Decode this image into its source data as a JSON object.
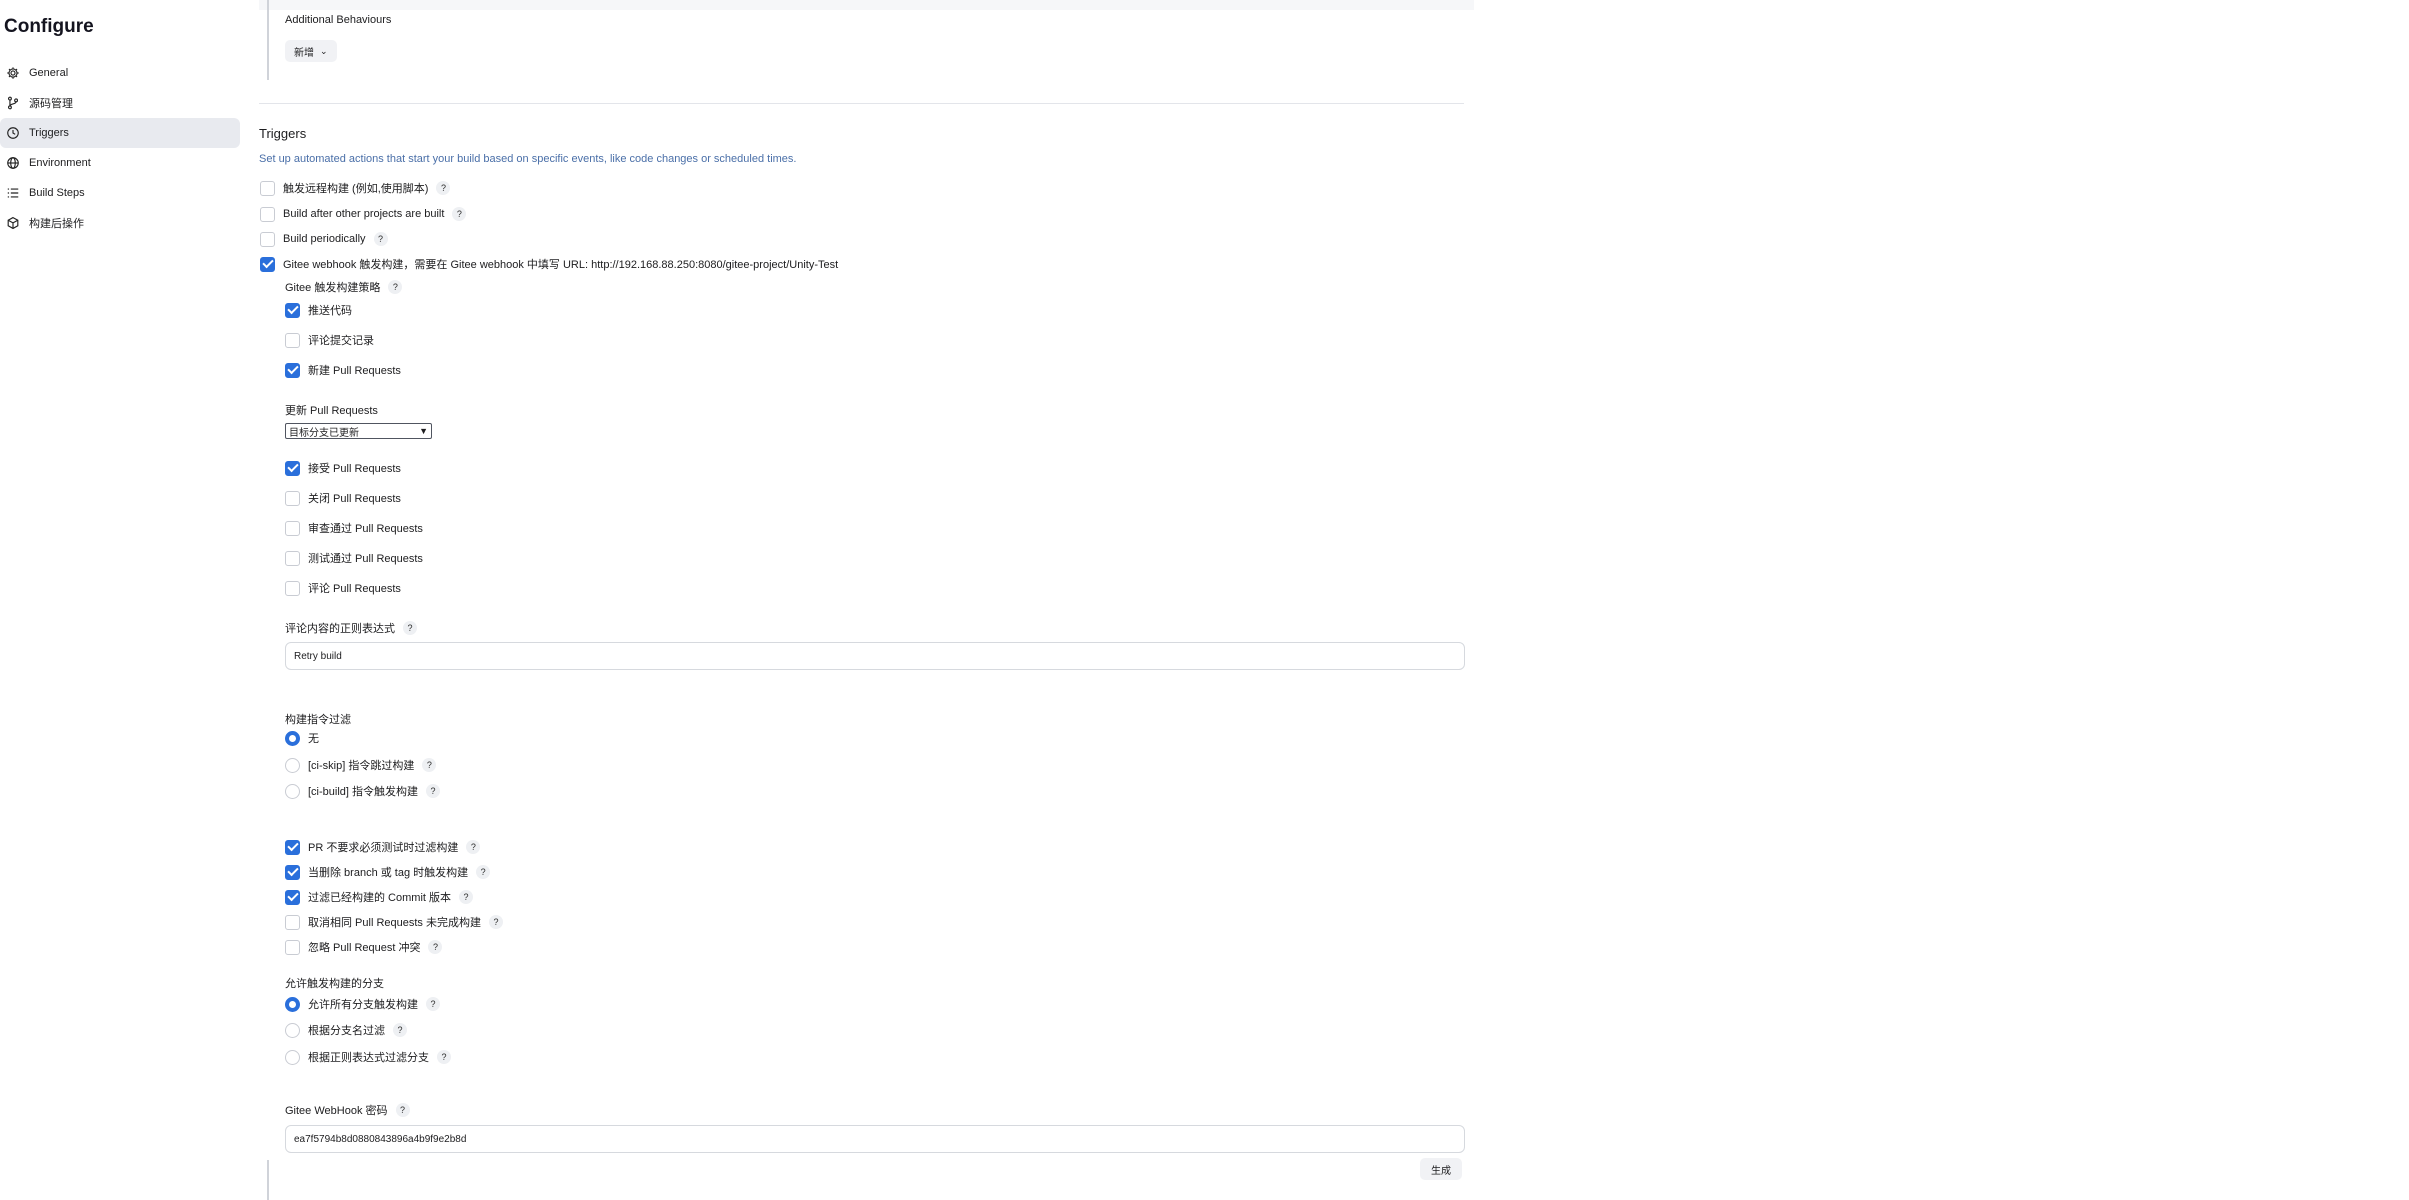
{
  "sidebar": {
    "title": "Configure",
    "items": [
      {
        "label": "General",
        "icon": "gear-icon"
      },
      {
        "label": "源码管理",
        "icon": "branch-icon"
      },
      {
        "label": "Triggers",
        "icon": "clock-icon"
      },
      {
        "label": "Environment",
        "icon": "globe-icon"
      },
      {
        "label": "Build Steps",
        "icon": "list-icon"
      },
      {
        "label": "构建后操作",
        "icon": "cube-icon"
      }
    ],
    "active_index": 2
  },
  "behaviours": {
    "label": "Additional Behaviours",
    "add_label": "新增"
  },
  "triggers": {
    "title": "Triggers",
    "description": "Set up automated actions that start your build based on specific events, like code changes or scheduled times.",
    "options": [
      {
        "label": "触发远程构建 (例如,使用脚本)",
        "checked": false
      },
      {
        "label": "Build after other projects are built",
        "checked": false
      },
      {
        "label": "Build periodically",
        "checked": false
      },
      {
        "label": "Gitee webhook 触发构建，需要在 Gitee webhook 中填写 URL: http://192.168.88.250:8080/gitee-project/Unity-Test",
        "checked": true
      }
    ]
  },
  "gitee": {
    "strategy_label": "Gitee 触发构建策略",
    "strategy_options": [
      {
        "label": "推送代码",
        "checked": true
      },
      {
        "label": "评论提交记录",
        "checked": false
      },
      {
        "label": "新建 Pull Requests",
        "checked": true
      }
    ],
    "update_pr_label": "更新 Pull Requests",
    "update_pr_selected": "目标分支已更新",
    "pr_options": [
      {
        "label": "接受 Pull Requests",
        "checked": true
      },
      {
        "label": "关闭 Pull Requests",
        "checked": false
      },
      {
        "label": "审查通过 Pull Requests",
        "checked": false
      },
      {
        "label": "测试通过 Pull Requests",
        "checked": false
      },
      {
        "label": "评论 Pull Requests",
        "checked": false
      }
    ],
    "comment_regex_label": "评论内容的正则表达式",
    "comment_regex_value": "Retry build",
    "build_filter_label": "构建指令过滤",
    "build_filter_options": [
      {
        "label": "无",
        "checked": true
      },
      {
        "label": "[ci-skip] 指令跳过构建",
        "checked": false
      },
      {
        "label": "[ci-build] 指令触发构建",
        "checked": false
      }
    ],
    "misc_options": [
      {
        "label": "PR 不要求必须测试时过滤构建",
        "checked": true
      },
      {
        "label": "当删除 branch 或 tag 时触发构建",
        "checked": true
      },
      {
        "label": "过滤已经构建的 Commit 版本",
        "checked": true
      },
      {
        "label": "取消相同 Pull Requests 未完成构建",
        "checked": false
      },
      {
        "label": "忽略 Pull Request 冲突",
        "checked": false
      }
    ],
    "branch_label": "允许触发构建的分支",
    "branch_options": [
      {
        "label": "允许所有分支触发构建",
        "checked": true
      },
      {
        "label": "根据分支名过滤",
        "checked": false
      },
      {
        "label": "根据正则表达式过滤分支",
        "checked": false
      }
    ],
    "webhook_secret_label": "Gitee WebHook 密码",
    "webhook_secret_value": "ea7f5794b8d0880843896a4b9f9e2b8d",
    "generate_label": "生成"
  }
}
